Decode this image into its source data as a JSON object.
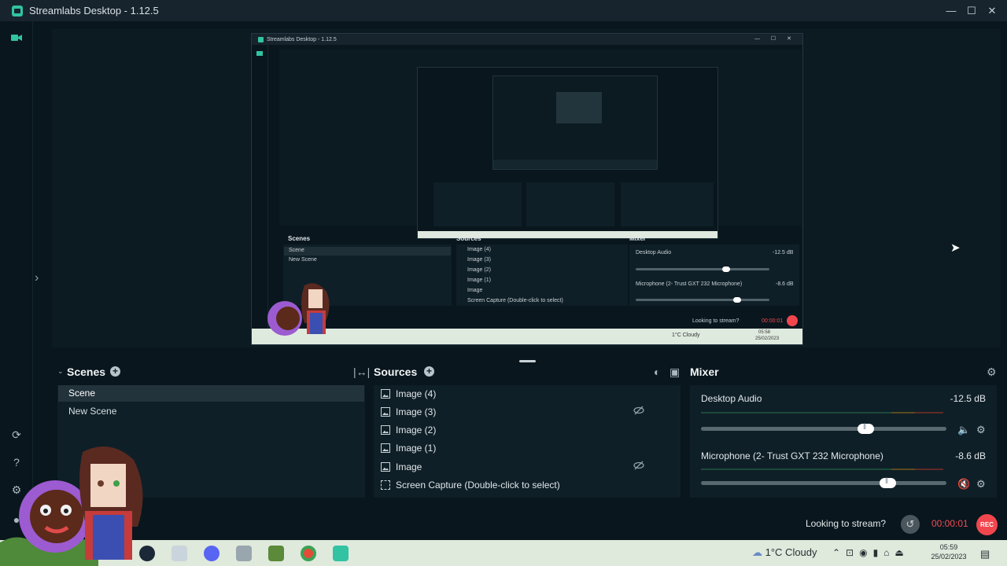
{
  "window": {
    "title": "Streamlabs Desktop - 1.12.5",
    "controls": [
      "—",
      "☐",
      "✕"
    ]
  },
  "inner": {
    "title": "Streamlabs Desktop - 1.12.5",
    "scenes_title": "Scenes",
    "sources_title": "Sources",
    "mixer_title": "Mixer",
    "scenes": [
      "Scene",
      "New Scene"
    ],
    "sources": [
      "Image (4)",
      "Image (3)",
      "Image (2)",
      "Image (1)",
      "Image",
      "Screen Capture (Double-click to select)"
    ],
    "mixer": [
      {
        "name": "Desktop Audio",
        "db": "-12.5 dB"
      },
      {
        "name": "Microphone (2- Trust GXT 232 Microphone)",
        "db": "-8.6 dB"
      }
    ],
    "looking": "Looking to stream?",
    "rec_time": "00:00:01",
    "weather": "1°C Cloudy",
    "time": "05:58",
    "date": "25/02/2023"
  },
  "scenes": {
    "title": "Scenes",
    "items": [
      "Scene",
      "New Scene"
    ]
  },
  "sources": {
    "title": "Sources",
    "items": [
      {
        "label": "Image (4)",
        "icon": "image-icon",
        "hidden": false
      },
      {
        "label": "Image (3)",
        "icon": "image-icon",
        "hidden": true
      },
      {
        "label": "Image (2)",
        "icon": "image-icon",
        "hidden": false
      },
      {
        "label": "Image (1)",
        "icon": "image-icon",
        "hidden": false
      },
      {
        "label": "Image",
        "icon": "image-icon",
        "hidden": true
      },
      {
        "label": "Screen Capture (Double-click to select)",
        "icon": "screen-capture-icon",
        "hidden": false
      }
    ]
  },
  "mixer": {
    "title": "Mixer",
    "channels": [
      {
        "name": "Desktop Audio",
        "db": "-12.5 dB",
        "volume": 0.67,
        "muted": false
      },
      {
        "name": "Microphone (2- Trust GXT 232 Microphone)",
        "db": "-8.6 dB",
        "volume": 0.76,
        "muted": true
      }
    ]
  },
  "footer": {
    "looking": "Looking to stream?",
    "rec_time": "00:00:01",
    "rec_label": "REC"
  },
  "taskbar": {
    "weather": "1°C Cloudy",
    "time": "05:59",
    "date": "25/02/2023",
    "apps": [
      "steam-icon",
      "pen-icon",
      "discord-icon",
      "mail-icon",
      "minecraft-icon",
      "chrome-icon",
      "streamlabs-icon"
    ]
  },
  "colors": {
    "accent": "#31c3a2",
    "rec": "#f2464f",
    "panel": "#0f1f27",
    "background": "#09161d",
    "taskbar": "#dfe9dc"
  }
}
